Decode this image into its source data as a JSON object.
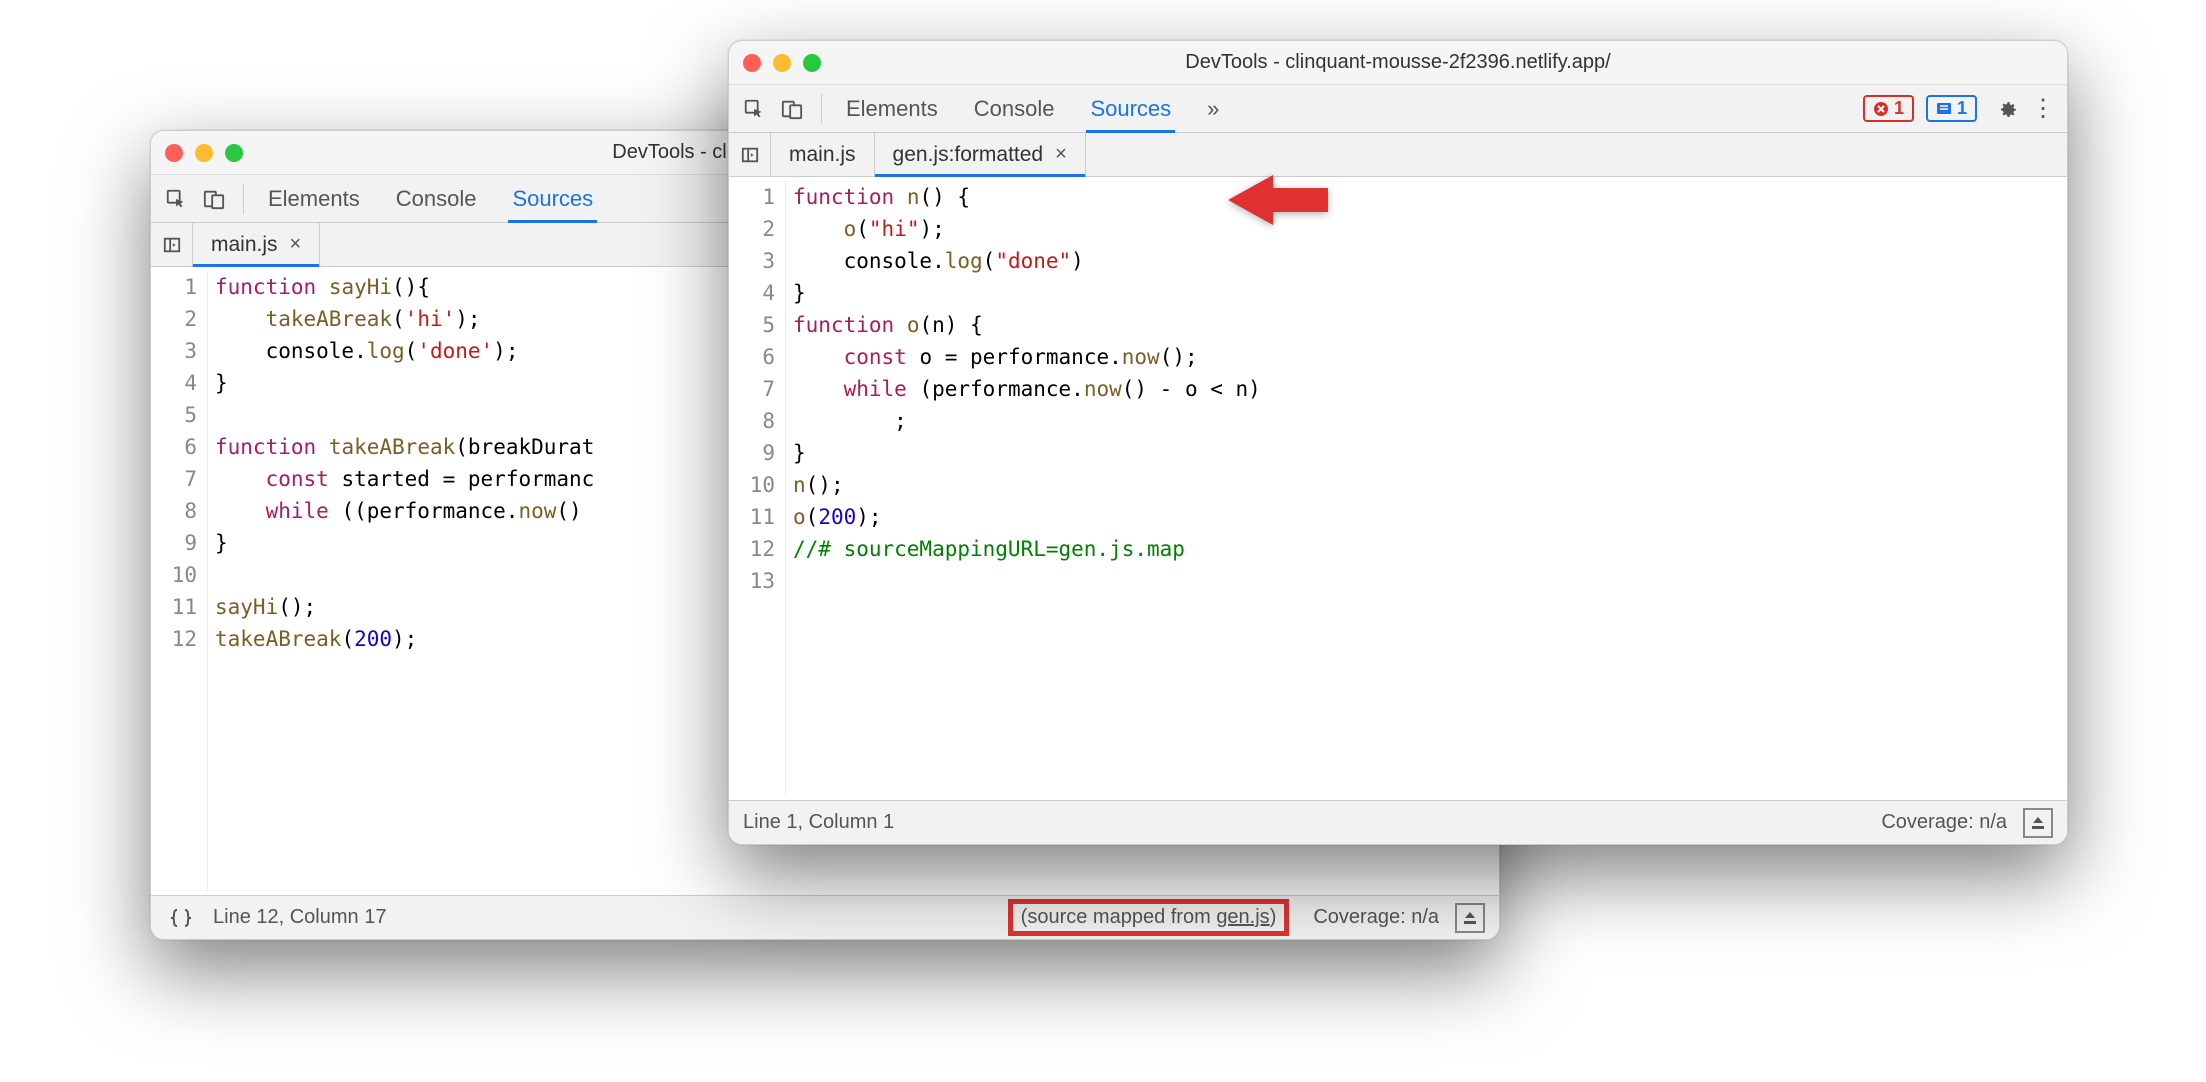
{
  "win1": {
    "title": "DevTools - clinquant-mousse-2f2396.netlify.app/",
    "tabs": [
      "Elements",
      "Console",
      "Sources"
    ],
    "activeTab": 2,
    "chevron": "»",
    "ftabs": [
      {
        "label": "main.js",
        "active": true,
        "closeable": true
      }
    ],
    "lines": [
      "1",
      "2",
      "3",
      "4",
      "5",
      "6",
      "7",
      "8",
      "9",
      "10",
      "11",
      "12"
    ],
    "status": {
      "pos": "Line 12, Column 17",
      "map_prefix": "(source mapped from ",
      "map_link": "gen.js",
      "map_suffix": ")",
      "cov": "Coverage: n/a"
    }
  },
  "win2": {
    "title": "DevTools - clinquant-mousse-2f2396.netlify.app/",
    "tabs": [
      "Elements",
      "Console",
      "Sources"
    ],
    "activeTab": 2,
    "chevron": "»",
    "errCount": "1",
    "infoCount": "1",
    "ftabs": [
      {
        "label": "main.js",
        "active": false,
        "closeable": false
      },
      {
        "label": "gen.js:formatted",
        "active": true,
        "closeable": true
      }
    ],
    "lines": [
      "1",
      "2",
      "3",
      "4",
      "5",
      "6",
      "7",
      "8",
      "9",
      "10",
      "11",
      "12",
      "13"
    ],
    "status": {
      "pos": "Line 1, Column 1",
      "cov": "Coverage: n/a"
    }
  }
}
